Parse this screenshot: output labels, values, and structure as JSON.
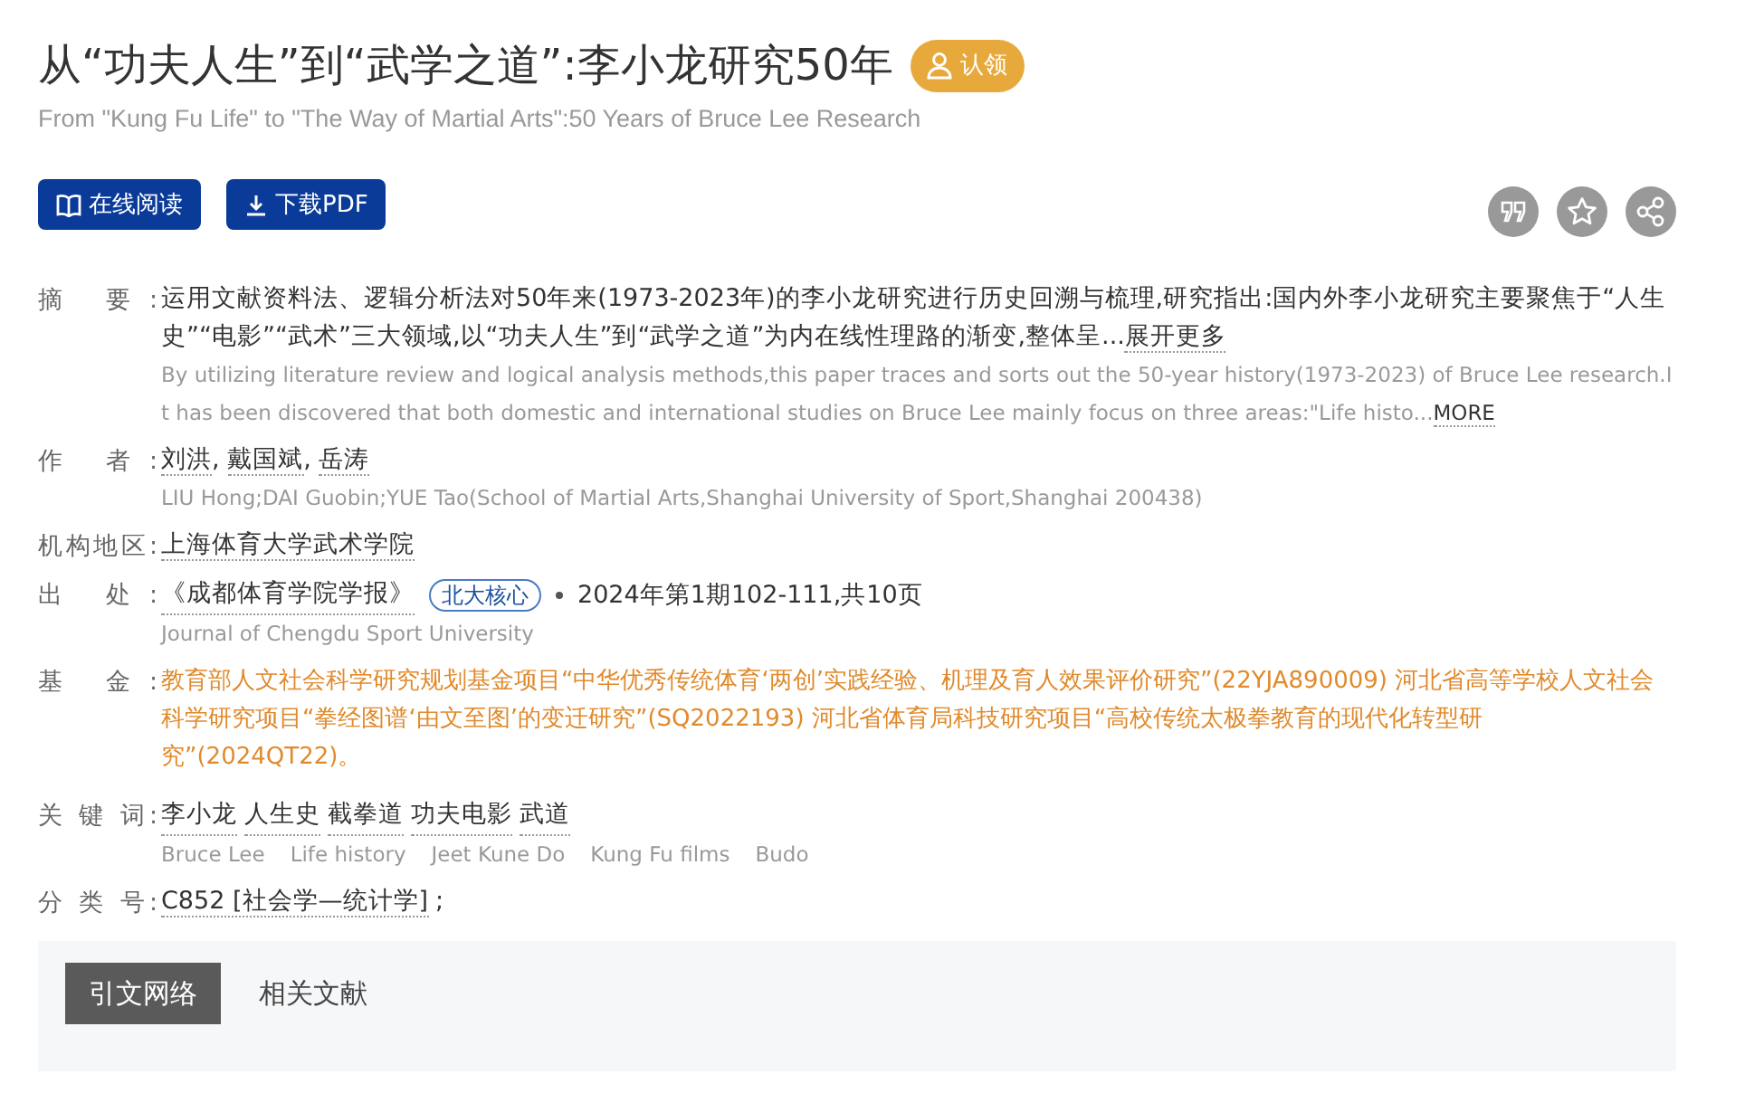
{
  "title": "从“功夫人生”到“武学之道”:李小龙研究50年",
  "claim_badge": "认领",
  "subtitle": "From \"Kung Fu Life\" to \"The Way of Martial Arts\":50 Years of Bruce Lee Research",
  "actions": [
    {
      "kind": "read",
      "label": "在线阅读"
    },
    {
      "kind": "download",
      "label": "下载PDF"
    }
  ],
  "tools": [
    {
      "kind": "quote"
    },
    {
      "kind": "star"
    },
    {
      "kind": "share"
    }
  ],
  "fields": [
    {
      "kind": "abstract",
      "label": "摘 要:",
      "text": "运用文献资料法、逻辑分析法对50年来(1973-2023年)的李小龙研究进行历史回溯与梳理,研究指出:国内外李小龙研究主要聚焦于“人生史”“电影”“武术”三大领域,以“功夫人生”到“武学之道”为内在线性理路的渐变,整体呈...",
      "more": "展开更多",
      "en": "By utilizing literature review and logical analysis methods,this paper traces and sorts out the 50-year history(1973-2023) of Bruce Lee research.It has been discovered that both domestic and international studies on Bruce Lee mainly focus on three areas:\"Life histo...",
      "en_more": "MORE"
    },
    {
      "kind": "links",
      "label": "作 者:",
      "links": [
        "刘洪",
        "戴国斌",
        "岳涛"
      ],
      "sep": ", ",
      "en": "LIU Hong;DAI Guobin;YUE Tao(School of Martial Arts,Shanghai University of Sport,Shanghai 200438)"
    },
    {
      "kind": "links",
      "label": "机构地区:",
      "links": [
        "上海体育大学武术学院"
      ]
    },
    {
      "kind": "source",
      "label": "出 处:",
      "journal": "《成都体育学院学报》",
      "tag": "北大核心",
      "detail": "2024年第1期102-111,共10页",
      "en": "Journal of Chengdu Sport University"
    },
    {
      "kind": "fund",
      "label": "基 金:",
      "text": "教育部人文社会科学研究规划基金项目“中华优秀传统体育‘两创’实践经验、机理及育人效果评价研究”(22YJA890009) 河北省高等学校人文社会科学研究项目“拳经图谱‘由文至图’的变迁研究”(SQ2022193) 河北省体育局科技研究项目“高校传统太极拳教育的现代化转型研究”(2024QT22)。"
    },
    {
      "kind": "keywords",
      "label": "关 键 词:",
      "links": [
        "李小龙",
        "人生史",
        "截拳道",
        "功夫电影",
        "武道"
      ],
      "en_list": [
        "Bruce Lee",
        "Life history",
        "Jeet Kune Do",
        "Kung Fu films",
        "Budo"
      ]
    },
    {
      "kind": "links",
      "label": "分 类 号:",
      "links": [
        "C852 [社会学—统计学]"
      ],
      "tail": ";"
    }
  ],
  "tabs": [
    {
      "label": "引文网络",
      "selected": true
    },
    {
      "label": "相关文献",
      "selected": false
    }
  ]
}
